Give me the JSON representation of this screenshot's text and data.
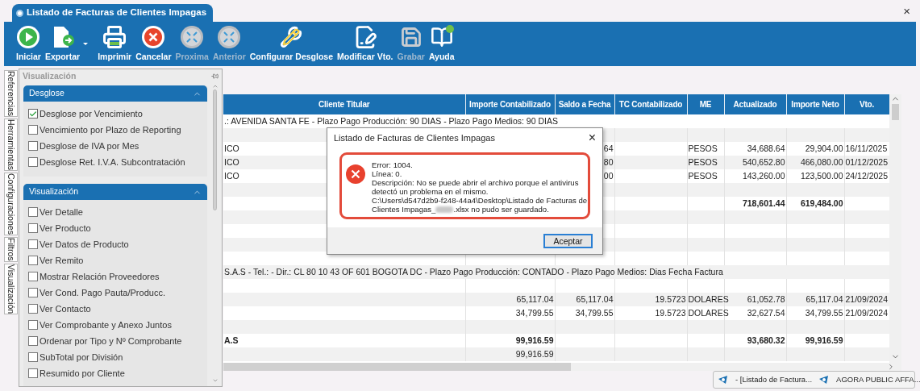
{
  "window": {
    "title": "Listado de Facturas de Clientes Impagas",
    "close": "×"
  },
  "toolbar": [
    {
      "label": "Iniciar",
      "disabled": false
    },
    {
      "label": "Exportar",
      "disabled": false,
      "dropdown": true
    },
    {
      "label": "Imprimir",
      "disabled": false
    },
    {
      "label": "Cancelar",
      "disabled": false
    },
    {
      "label": "Proxima",
      "disabled": true
    },
    {
      "label": "Anterior",
      "disabled": true
    },
    {
      "label": "Configurar Desglose",
      "disabled": false
    },
    {
      "label": "Modificar Vto.",
      "disabled": false
    },
    {
      "label": "Grabar",
      "disabled": true
    },
    {
      "label": "Ayuda",
      "disabled": false
    }
  ],
  "side_tabs": [
    "Referencias",
    "Herramientas",
    "Configuraciones",
    "Filtros",
    "Visualización"
  ],
  "panel": {
    "title": "Visualización",
    "sections": [
      {
        "title": "Desglose",
        "expanded": true,
        "options": [
          {
            "label": "Desglose por Vencimiento",
            "checked": true
          },
          {
            "label": "Vencimiento por Plazo de Reporting",
            "checked": false
          },
          {
            "label": "Desglose de IVA por Mes",
            "checked": false
          },
          {
            "label": "Desglose Ret.  I.V.A. Subcontratación",
            "checked": false
          }
        ]
      },
      {
        "title": "Visualización",
        "expanded": true,
        "options": [
          {
            "label": "Ver Detalle",
            "checked": false
          },
          {
            "label": "Ver Producto",
            "checked": false
          },
          {
            "label": "Ver Datos de Producto",
            "checked": false
          },
          {
            "label": "Ver Remito",
            "checked": false
          },
          {
            "label": "Mostrar Relación Proveedores",
            "checked": false
          },
          {
            "label": "Ver Cond. Pago Pauta/Producc.",
            "checked": false
          },
          {
            "label": "Ver Contacto",
            "checked": false
          },
          {
            "label": "Ver Comprobante y Anexo Juntos",
            "checked": false
          },
          {
            "label": "Ordenar por Tipo y Nº Comprobante",
            "checked": false
          },
          {
            "label": "SubTotal por División",
            "checked": false
          },
          {
            "label": "Resumido por Cliente",
            "checked": false
          }
        ]
      }
    ]
  },
  "table": {
    "columns": [
      "Cliente Titular",
      "Importe Contabilizado",
      "Saldo a Fecha",
      "TC Contabilizado",
      "ME",
      "Actualizado",
      "Importe Neto",
      "Vto."
    ],
    "rows": [
      {
        "kind": "group",
        "text": ".: AVENIDA SANTA FE - Plazo Pago Producción: 90 DIAS - Plazo Pago Medios: 90 DIAS"
      },
      {
        "kind": "empty"
      },
      {
        "kind": "data",
        "bold": false,
        "cells": [
          "ICO",
          null,
          "64",
          null,
          "PESOS",
          "34,688.64",
          "29,904.00",
          "16/11/2025"
        ]
      },
      {
        "kind": "data",
        "bold": false,
        "cells": [
          "ICO",
          null,
          "80",
          null,
          "PESOS",
          "540,652.80",
          "466,080.00",
          "01/12/2025"
        ]
      },
      {
        "kind": "data",
        "bold": false,
        "cells": [
          "ICO",
          null,
          "00",
          null,
          "PESOS",
          "143,260.00",
          "123,500.00",
          "24/12/2025"
        ]
      },
      {
        "kind": "empty"
      },
      {
        "kind": "data",
        "bold": true,
        "cells": [
          null,
          null,
          null,
          null,
          null,
          "718,601.44",
          "619,484.00",
          null
        ]
      },
      {
        "kind": "empty"
      },
      {
        "kind": "empty"
      },
      {
        "kind": "empty"
      },
      {
        "kind": "empty"
      },
      {
        "kind": "group",
        "text": "S.A.S - Tel.:  - Dir.: CL 80 10 43 OF 601 BOGOTA DC - Plazo Pago Producción: CONTADO - Plazo Pago Medios: Dias Fecha Factura"
      },
      {
        "kind": "empty"
      },
      {
        "kind": "data",
        "bold": false,
        "cells": [
          null,
          "65,117.04",
          "65,117.04",
          "19.5723",
          "DOLARES",
          "61,052.78",
          "65,117.04",
          "21/09/2024"
        ]
      },
      {
        "kind": "data",
        "bold": false,
        "cells": [
          null,
          "34,799.55",
          "34,799.55",
          "19.5723",
          "DOLARES",
          "32,627.54",
          "34,799.55",
          "21/09/2024"
        ]
      },
      {
        "kind": "empty"
      },
      {
        "kind": "data",
        "bold": true,
        "cells": [
          "A.S",
          "99,916.59",
          null,
          null,
          null,
          "93,680.32",
          "99,916.59",
          null
        ]
      },
      {
        "kind": "data",
        "bold": false,
        "cells": [
          null,
          "99,916.59",
          null,
          null,
          null,
          null,
          null,
          null
        ]
      }
    ]
  },
  "dialog": {
    "title": "Listado de Facturas de Clientes Impagas",
    "close": "×",
    "lines": [
      "Error: 1004.",
      "Línea: 0.",
      "Descripción: No se puede abrir el archivo porque el antivirus",
      "detectó un problema en el mismo.",
      "C:\\Users\\d547d2b9-f248-44a4\\Desktop\\Listado de Facturas de"
    ],
    "last_line_start": "Clientes Impagas_",
    "redacted": true,
    "last_line_end": ".xlsx no pudo ser guardado.",
    "button": "Aceptar"
  },
  "taskbar": [
    {
      "label": "- [Listado de Factura..."
    },
    {
      "label": "AGORA PUBLIC AFFA..."
    }
  ]
}
